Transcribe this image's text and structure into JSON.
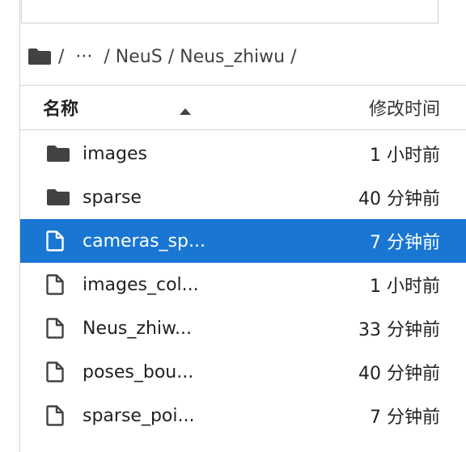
{
  "breadcrumb": {
    "root": "/",
    "ellipsis": "···",
    "segments": [
      "/ NeuS",
      "/ Neus_zhiwu",
      "/"
    ]
  },
  "header": {
    "name_label": "名称",
    "modified_label": "修改时间",
    "sort_direction": "ascending"
  },
  "colors": {
    "selected_bg": "#1976d2",
    "icon_dark": "#424242"
  },
  "files": [
    {
      "name": "images",
      "modified": "1 小时前",
      "type": "folder",
      "selected": false
    },
    {
      "name": "sparse",
      "modified": "40 分钟前",
      "type": "folder",
      "selected": false
    },
    {
      "name": "cameras_sp...",
      "modified": "7 分钟前",
      "type": "file",
      "selected": true
    },
    {
      "name": "images_col...",
      "modified": "1 小时前",
      "type": "file",
      "selected": false
    },
    {
      "name": "Neus_zhiw...",
      "modified": "33 分钟前",
      "type": "file",
      "selected": false
    },
    {
      "name": "poses_bou...",
      "modified": "40 分钟前",
      "type": "file",
      "selected": false
    },
    {
      "name": "sparse_poi...",
      "modified": "7 分钟前",
      "type": "file",
      "selected": false
    }
  ]
}
